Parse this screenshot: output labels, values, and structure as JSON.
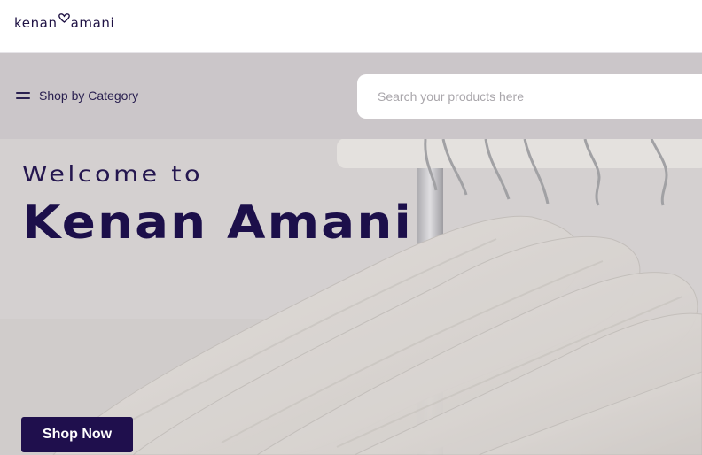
{
  "header": {
    "logo": {
      "left": "kenan",
      "right": "amani",
      "icon": "heart-icon"
    }
  },
  "nav": {
    "category_label": "Shop by Category",
    "category_icon": "hamburger-menu-icon"
  },
  "search": {
    "placeholder": "Search your products here",
    "value": ""
  },
  "hero": {
    "welcome": "Welcome to",
    "title": "Kenan Amani",
    "cta_label": "Shop Now",
    "image": "white-clothes-hangers-on-rail"
  },
  "colors": {
    "brand": "#1f0f4d",
    "hero_background": "#d2cecf",
    "search_background": "#ffffff"
  }
}
